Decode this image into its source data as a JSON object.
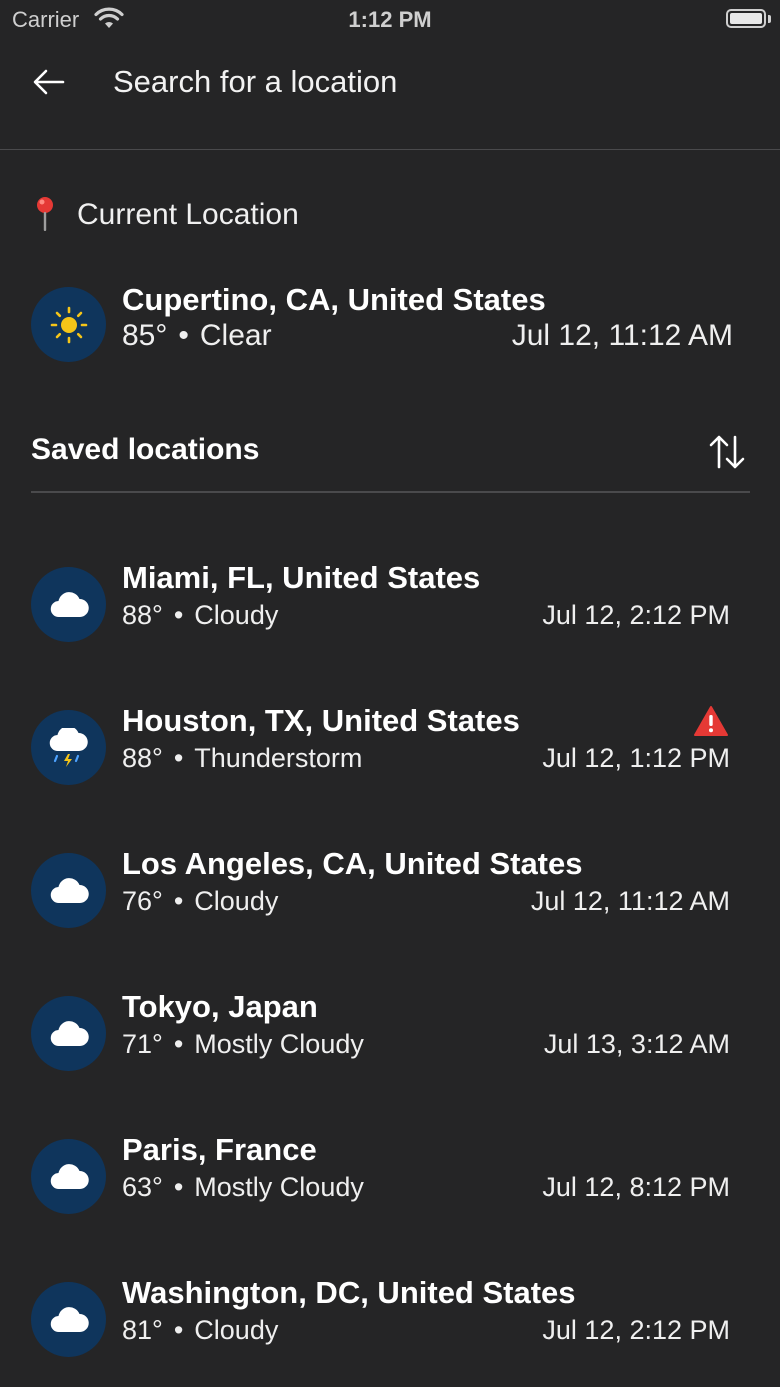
{
  "status_bar": {
    "carrier": "Carrier",
    "time": "1:12 PM"
  },
  "header": {
    "search_placeholder": "Search for a location",
    "back_icon": "arrow-left-icon"
  },
  "current_location": {
    "label": "Current Location",
    "icon": "map-pin-icon",
    "name": "Cupertino, CA, United States",
    "temperature": "85°",
    "condition": "Clear",
    "time": "Jul 12, 11:12 AM",
    "weather_icon": "sun-icon"
  },
  "saved": {
    "title": "Saved locations",
    "sort_icon": "sort-arrows-icon",
    "items": [
      {
        "name": "Miami, FL, United States",
        "temperature": "88°",
        "condition": "Cloudy",
        "time": "Jul 12, 2:12 PM",
        "weather_icon": "cloud-icon",
        "alert": false
      },
      {
        "name": "Houston, TX, United States",
        "temperature": "88°",
        "condition": "Thunderstorm",
        "time": "Jul 12, 1:12 PM",
        "weather_icon": "thunderstorm-icon",
        "alert": true
      },
      {
        "name": "Los Angeles, CA, United States",
        "temperature": "76°",
        "condition": "Cloudy",
        "time": "Jul 12, 11:12 AM",
        "weather_icon": "cloud-icon",
        "alert": false
      },
      {
        "name": "Tokyo, Japan",
        "temperature": "71°",
        "condition": "Mostly Cloudy",
        "time": "Jul 13, 3:12 AM",
        "weather_icon": "cloud-icon",
        "alert": false
      },
      {
        "name": "Paris, France",
        "temperature": "63°",
        "condition": "Mostly Cloudy",
        "time": "Jul 12, 8:12 PM",
        "weather_icon": "cloud-icon",
        "alert": false
      },
      {
        "name": "Washington, DC, United States",
        "temperature": "81°",
        "condition": "Cloudy",
        "time": "Jul 12, 2:12 PM",
        "weather_icon": "cloud-icon",
        "alert": false
      }
    ]
  },
  "colors": {
    "background": "#252526",
    "icon_circle": "#0f355c",
    "sun": "#f5c518",
    "alert": "#e53935",
    "pin": "#e53935"
  }
}
